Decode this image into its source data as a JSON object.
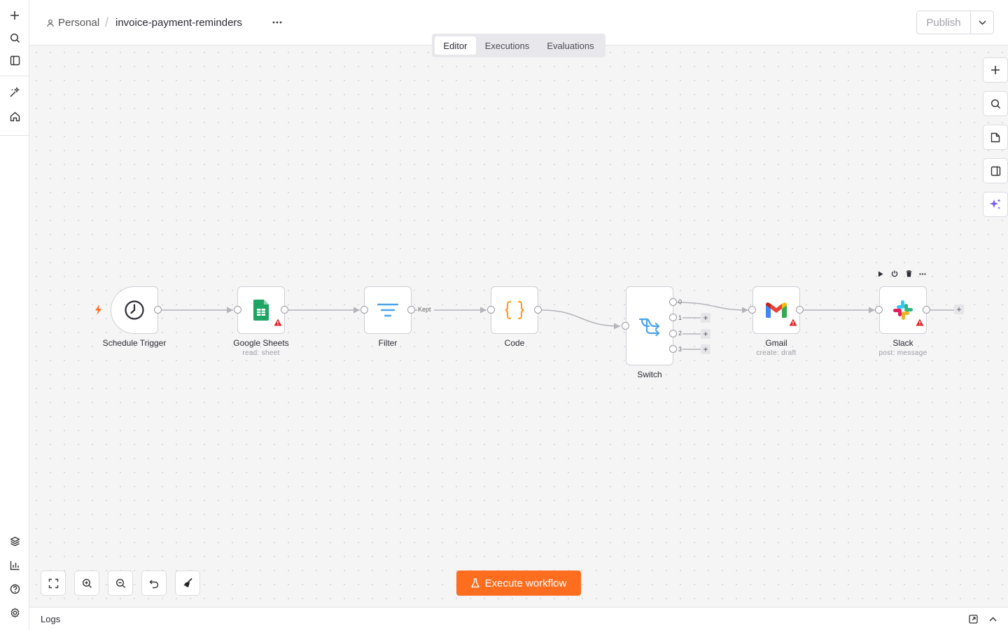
{
  "header": {
    "project": "Personal",
    "workflow_name": "invoice-payment-reminders",
    "publish_label": "Publish"
  },
  "tabs": [
    {
      "label": "Editor",
      "active": true
    },
    {
      "label": "Executions",
      "active": false
    },
    {
      "label": "Evaluations",
      "active": false
    }
  ],
  "rail": {
    "top_icons": [
      "plus-icon",
      "search-icon",
      "sidebar-toggle-icon",
      "sparkle-wand-icon",
      "home-icon"
    ],
    "bottom_icons": [
      "templates-icon",
      "insights-icon",
      "help-icon",
      "settings-icon"
    ]
  },
  "nodes": [
    {
      "name": "Schedule Trigger",
      "subtitle": ""
    },
    {
      "name": "Google Sheets",
      "subtitle": "read: sheet"
    },
    {
      "name": "Filter",
      "subtitle": ""
    },
    {
      "name": "Code",
      "subtitle": ""
    },
    {
      "name": "Switch",
      "subtitle": ""
    },
    {
      "name": "Gmail",
      "subtitle": "create: draft"
    },
    {
      "name": "Slack",
      "subtitle": "post: message"
    }
  ],
  "edge_labels": {
    "filter_kept": "Kept"
  },
  "switch_outputs": [
    "0",
    "1",
    "2",
    "3"
  ],
  "execute_label": "Execute workflow",
  "logs_label": "Logs",
  "colors": {
    "accent": "#ff6d1f",
    "warning": "#e0242b",
    "canvas": "#f5f5f5"
  }
}
